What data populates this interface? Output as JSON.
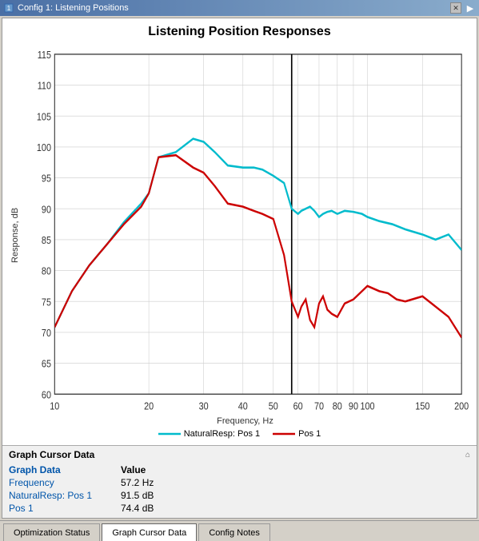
{
  "titleBar": {
    "title": "Config 1: Listening Positions",
    "closeLabel": "✕",
    "arrowLabel": "▶"
  },
  "chart": {
    "title": "Listening Position Responses",
    "yAxisLabel": "Response, dB",
    "xAxisLabel": "Frequency, Hz",
    "yMin": 60,
    "yMax": 115,
    "xAxisTicks": [
      "10",
      "20",
      "30",
      "40",
      "50",
      "60",
      "70",
      "80",
      "90",
      "100",
      "150",
      "200"
    ],
    "yAxisTicks": [
      "115",
      "110",
      "105",
      "100",
      "95",
      "90",
      "85",
      "80",
      "75",
      "70",
      "65",
      "60"
    ],
    "cursorX": 57
  },
  "legend": {
    "items": [
      {
        "label": "NaturalResp: Pos 1",
        "color": "#00BBCC",
        "id": "legend-natural"
      },
      {
        "label": "Pos 1",
        "color": "#CC0000",
        "id": "legend-pos1"
      }
    ]
  },
  "cursorData": {
    "header": "Graph Cursor Data",
    "pinIcon": "📌",
    "columnHeaders": [
      "Graph Data",
      "Value"
    ],
    "rows": [
      {
        "label": "Frequency",
        "value": "57.2 Hz"
      },
      {
        "label": "NaturalResp: Pos 1",
        "value": "91.5 dB"
      },
      {
        "label": "Pos 1",
        "value": "74.4 dB"
      }
    ]
  },
  "tabs": [
    {
      "label": "Optimization Status",
      "active": false
    },
    {
      "label": "Graph Cursor Data",
      "active": true
    },
    {
      "label": "Config Notes",
      "active": false
    }
  ]
}
